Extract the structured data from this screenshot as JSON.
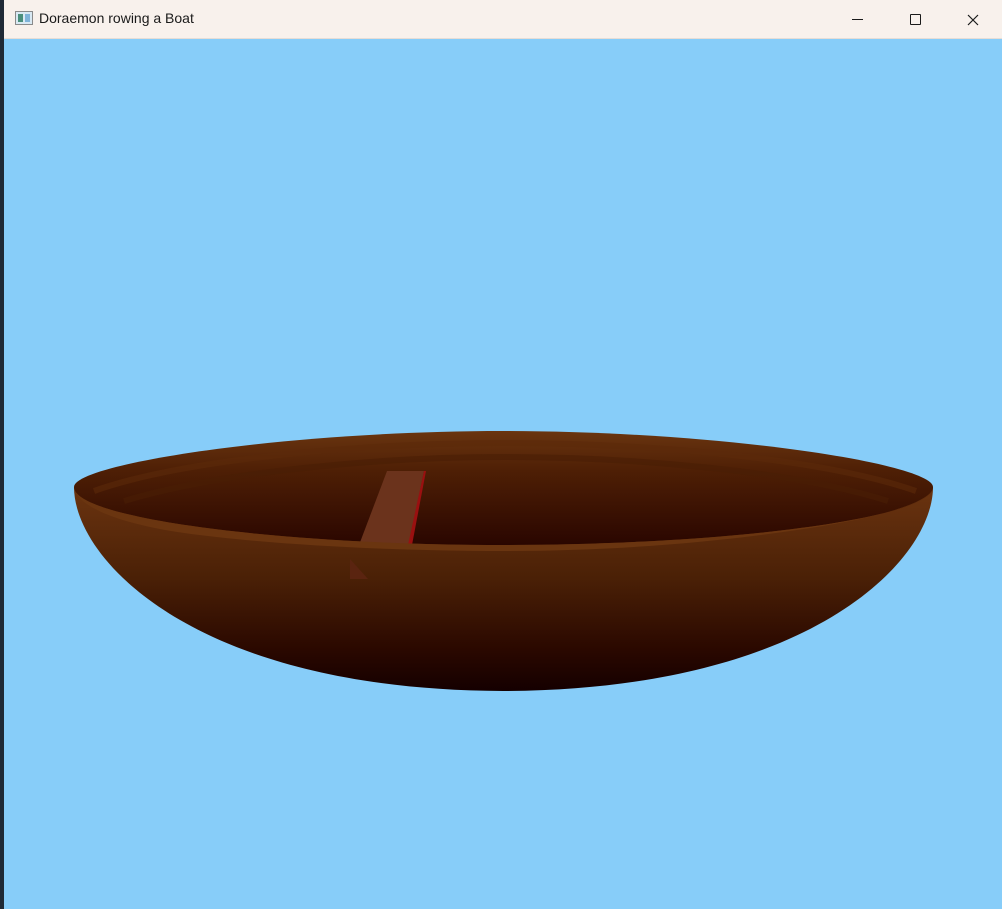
{
  "window": {
    "title": "Doraemon rowing a Boat",
    "icon": "opengl-app-icon",
    "controls": [
      "minimize-icon",
      "maximize-icon",
      "close-icon"
    ]
  },
  "scene": {
    "background_color": "#87cdf9",
    "boat_rim_color": "#6a3510",
    "boat_inner_dark_color": "#2a0600",
    "boat_hull_light_color": "#6b3410",
    "boat_hull_dark_color": "#1a0000",
    "oar_color": "#6b331c",
    "oar_edge_color": "#9a1010"
  }
}
